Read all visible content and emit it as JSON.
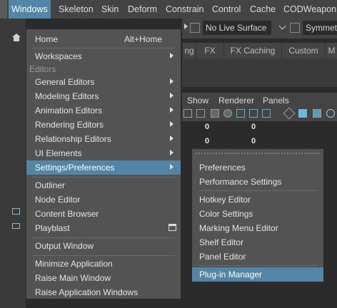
{
  "menubar": {
    "items": [
      "Windows",
      "Skeleton",
      "Skin",
      "Deform",
      "Constrain",
      "Control",
      "Cache",
      "CODWeaponPr"
    ]
  },
  "background": {
    "toolbar": {
      "live_surface": "No Live Surface",
      "symmetry": "Symmetri"
    },
    "tabs": [
      "ng",
      "FX",
      "FX Caching",
      "Custom",
      "M"
    ],
    "panel_menu": [
      "Show",
      "Renderer",
      "Panels"
    ],
    "values": [
      "0",
      "0",
      "0",
      "0"
    ]
  },
  "windows_menu": {
    "home": "Home",
    "home_shortcut": "Alt+Home",
    "workspaces": "Workspaces",
    "section_editors": "Editors",
    "general_editors": "General Editors",
    "modeling_editors": "Modeling Editors",
    "animation_editors": "Animation Editors",
    "rendering_editors": "Rendering Editors",
    "relationship_editors": "Relationship Editors",
    "ui_elements": "UI Elements",
    "settings_preferences": "Settings/Preferences",
    "outliner": "Outliner",
    "node_editor": "Node Editor",
    "content_browser": "Content Browser",
    "playblast": "Playblast",
    "output_window": "Output Window",
    "minimize_application": "Minimize Application",
    "raise_main_window": "Raise Main Window",
    "raise_application_windows": "Raise Application Windows"
  },
  "settings_submenu": {
    "preferences": "Preferences",
    "performance_settings": "Performance Settings",
    "hotkey_editor": "Hotkey Editor",
    "color_settings": "Color Settings",
    "marking_menu_editor": "Marking Menu Editor",
    "shelf_editor": "Shelf Editor",
    "panel_editor": "Panel Editor",
    "plugin_manager": "Plug-in Manager"
  }
}
